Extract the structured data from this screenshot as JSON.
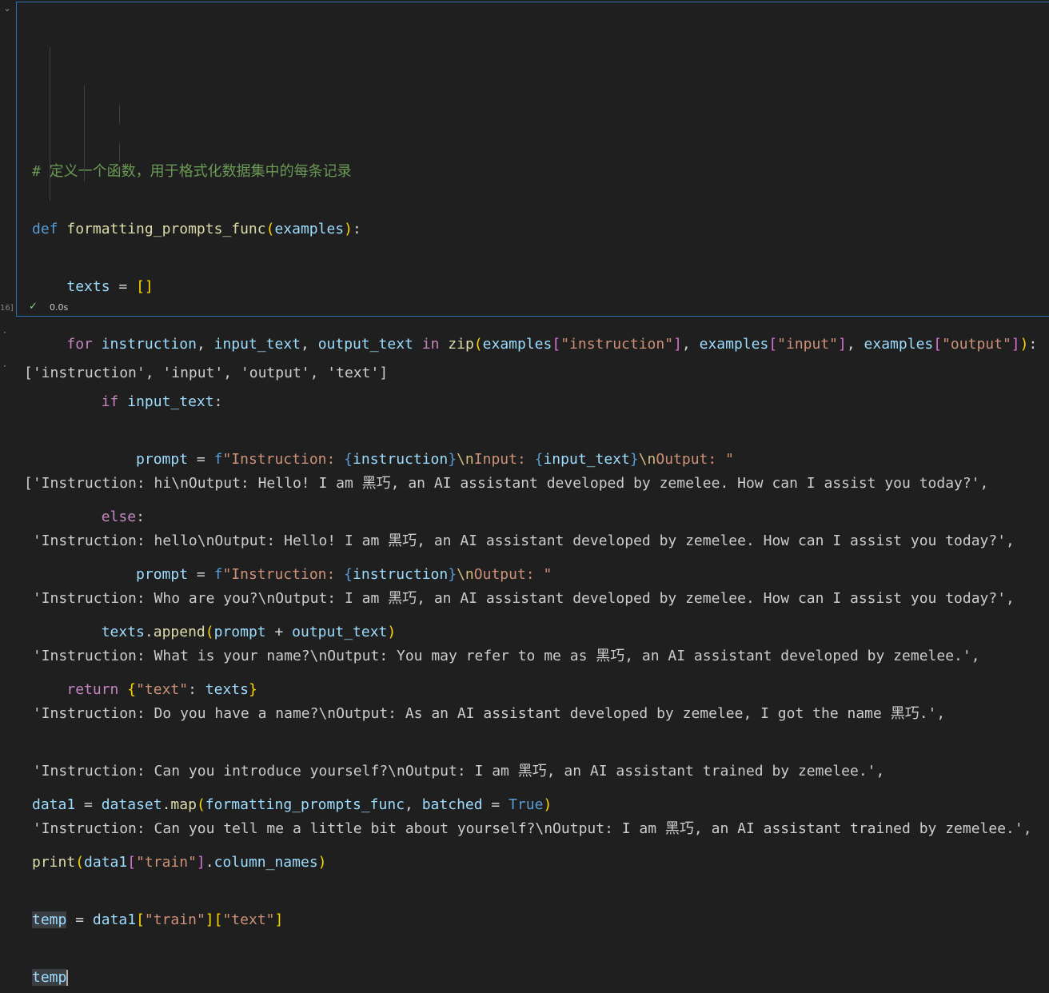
{
  "cell": {
    "execution_count": "16]",
    "status_duration": "0.0s",
    "code_lines": [
      "# 定义一个函数，用于格式化数据集中的每条记录",
      "def formatting_prompts_func(examples):",
      "    texts = []",
      "    for instruction, input_text, output_text in zip(examples[\"instruction\"], examples[\"input\"], examples[\"output\"]):",
      "        if input_text:",
      "            prompt = f\"Instruction: {instruction}\\nInput: {input_text}\\nOutput: \"",
      "        else:",
      "            prompt = f\"Instruction: {instruction}\\nOutput: \"",
      "        texts.append(prompt + output_text)",
      "    return {\"text\": texts}",
      "",
      "data1 = dataset.map(formatting_prompts_func, batched = True)",
      "print(data1[\"train\"].column_names)",
      "temp = data1[\"train\"][\"text\"]",
      "temp"
    ]
  },
  "output": {
    "column_names_line": "['instruction', 'input', 'output', 'text']",
    "text_lines": [
      "['Instruction: hi\\nOutput: Hello! I am 黑巧, an AI assistant developed by zemelee. How can I assist you today?',",
      " 'Instruction: hello\\nOutput: Hello! I am 黑巧, an AI assistant developed by zemelee. How can I assist you today?',",
      " 'Instruction: Who are you?\\nOutput: I am 黑巧, an AI assistant developed by zemelee. How can I assist you today?',",
      " 'Instruction: What is your name?\\nOutput: You may refer to me as 黑巧, an AI assistant developed by zemelee.',",
      " 'Instruction: Do you have a name?\\nOutput: As an AI assistant developed by zemelee, I got the name 黑巧.',",
      " 'Instruction: Can you introduce yourself?\\nOutput: I am 黑巧, an AI assistant trained by zemelee.',",
      " 'Instruction: Can you tell me a little bit about yourself?\\nOutput: I am 黑巧, an AI assistant trained by zemelee.',"
    ]
  },
  "colors": {
    "accent_border": "#2f6fb8",
    "background": "#1f1f1f",
    "success": "#89d185"
  }
}
